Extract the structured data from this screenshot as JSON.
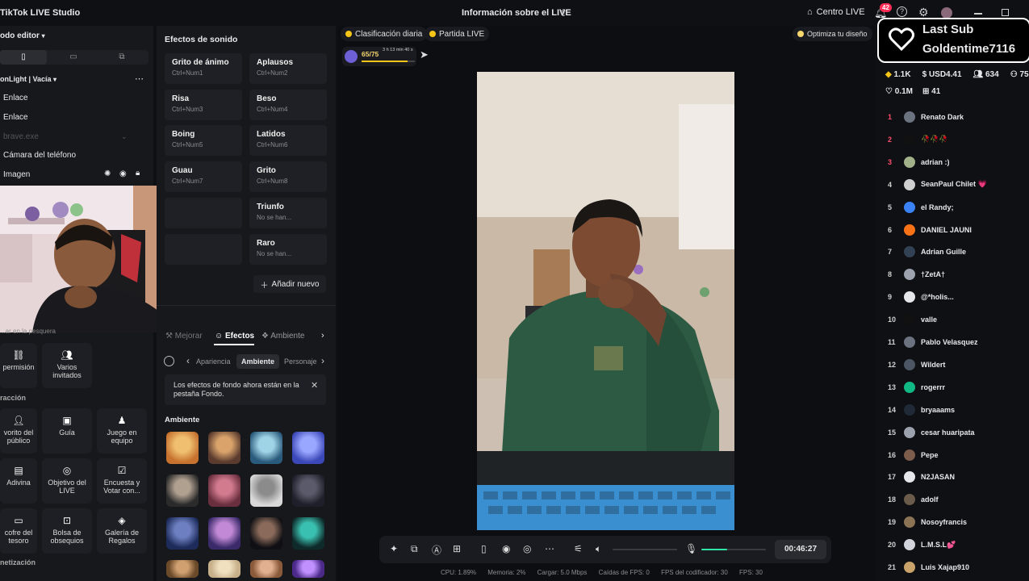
{
  "titlebar": {
    "app_title": "TikTok LIVE Studio",
    "center_title": "Información sobre el LIVE",
    "home_label": "Centro LIVE",
    "notifications_count": "42"
  },
  "left": {
    "mode_editor": "odo editor",
    "scene_name": "onLight | Vacía",
    "rows": [
      "Enlace",
      "Enlace",
      "brave.exe",
      "Cámara del teléfono",
      "Imagen"
    ],
    "clip_label": "...ar en la pesquera",
    "tiles_row1": [
      "permisión",
      "Varios invitados"
    ],
    "section_interaction": "racción",
    "tiles_row2": [
      "vorito del público",
      "Guía",
      "Juego en equipo"
    ],
    "tiles_row3": [
      "Adivina",
      "Objetivo del LIVE",
      "Encuesta y Votar con..."
    ],
    "tiles_row4": [
      "cofre del tesoro",
      "Bolsa de obsequios",
      "Galería de Regalos"
    ],
    "section_monetization": "netización"
  },
  "middle": {
    "sound_title": "Efectos de sonido",
    "sounds": [
      {
        "name": "Grito de ánimo",
        "key": "Ctrl+Num1"
      },
      {
        "name": "Aplausos",
        "key": "Ctrl+Num2"
      },
      {
        "name": "Risa",
        "key": "Ctrl+Num3"
      },
      {
        "name": "Beso",
        "key": "Ctrl+Num4"
      },
      {
        "name": "Boing",
        "key": "Ctrl+Num5"
      },
      {
        "name": "Latidos",
        "key": "Ctrl+Num6"
      },
      {
        "name": "Guau",
        "key": "Ctrl+Num7"
      },
      {
        "name": "Grito",
        "key": "Ctrl+Num8"
      },
      {
        "name": "",
        "key": ""
      },
      {
        "name": "Triunfo",
        "key": "No se han..."
      },
      {
        "name": "",
        "key": ""
      },
      {
        "name": "Raro",
        "key": "No se han..."
      }
    ],
    "add_new": "Añadir nuevo",
    "tabs": [
      "Mejorar",
      "Efectos",
      "Ambiente"
    ],
    "subtabs": [
      "Apariencia",
      "Ambiente",
      "Personaje"
    ],
    "notice": "Los efectos de fondo ahora están en la pestaña Fondo.",
    "ambient_title": "Ambiente"
  },
  "stage": {
    "pill_daily": "Clasificación diaria",
    "pill_match": "Partida LIVE",
    "pill_optimize": "Optimiza tu diseño",
    "level_progress": "65/75",
    "level_timer": "3 h 13 min 40 s",
    "timer": "00:46:27"
  },
  "stats": {
    "cpu": "CPU: 1.89%",
    "memory": "Memoria: 2%",
    "upload": "Cargar: 5.0 Mbps",
    "fps_drops": "Caídas de FPS: 0",
    "encoder_fps": "FPS del codificador: 30",
    "fps": "FPS: 30"
  },
  "right": {
    "last_sub_title": "Last Sub",
    "last_sub_name": "Goldentime7116",
    "stat_coins": "1.1K",
    "stat_usd": "USD4.41",
    "stat_viewers": "634",
    "stat_other": "75",
    "stat_likes": "0.1M",
    "stat_gifts": "41",
    "leaderboard": [
      {
        "rank": "1",
        "name": "Renato Dark",
        "color": "#6b7280"
      },
      {
        "rank": "2",
        "name": "🥀🥀🥀",
        "color": "#111111"
      },
      {
        "rank": "3",
        "name": "adrian :)",
        "color": "#a3b18a"
      },
      {
        "rank": "4",
        "name": "SeanPaul Chilet 💗",
        "color": "#cfcfcf"
      },
      {
        "rank": "5",
        "name": "el Randy;",
        "color": "#3b82f6"
      },
      {
        "rank": "6",
        "name": "DANIEL JAUNI",
        "color": "#f97316"
      },
      {
        "rank": "7",
        "name": "Adrian Guille",
        "color": "#334155"
      },
      {
        "rank": "8",
        "name": "†ZetA†",
        "color": "#9ca3af"
      },
      {
        "rank": "9",
        "name": "@*holis...",
        "color": "#e5e7eb"
      },
      {
        "rank": "10",
        "name": "valle",
        "color": "#111111"
      },
      {
        "rank": "11",
        "name": "Pablo Velasquez",
        "color": "#6b7280"
      },
      {
        "rank": "12",
        "name": "Wildert",
        "color": "#4b5563"
      },
      {
        "rank": "13",
        "name": "rogerrr",
        "color": "#10b981"
      },
      {
        "rank": "14",
        "name": "bryaaams",
        "color": "#1f2937"
      },
      {
        "rank": "15",
        "name": "cesar huaripata",
        "color": "#9ca3af"
      },
      {
        "rank": "16",
        "name": "Pepe",
        "color": "#7c5c4a"
      },
      {
        "rank": "17",
        "name": "N2JASAN",
        "color": "#e5e7eb"
      },
      {
        "rank": "18",
        "name": "adolf",
        "color": "#6b5b4a"
      },
      {
        "rank": "19",
        "name": "Nosoyfrancis",
        "color": "#8b7355"
      },
      {
        "rank": "20",
        "name": "L.M.S.L💕",
        "color": "#d1d5db"
      },
      {
        "rank": "21",
        "name": "Luis Xajap910",
        "color": "#c9a36a"
      }
    ]
  },
  "colors": {
    "accent": "#fe2c55",
    "rank_red": "#ff4d6d",
    "mic_level": "#2ee6a6"
  }
}
